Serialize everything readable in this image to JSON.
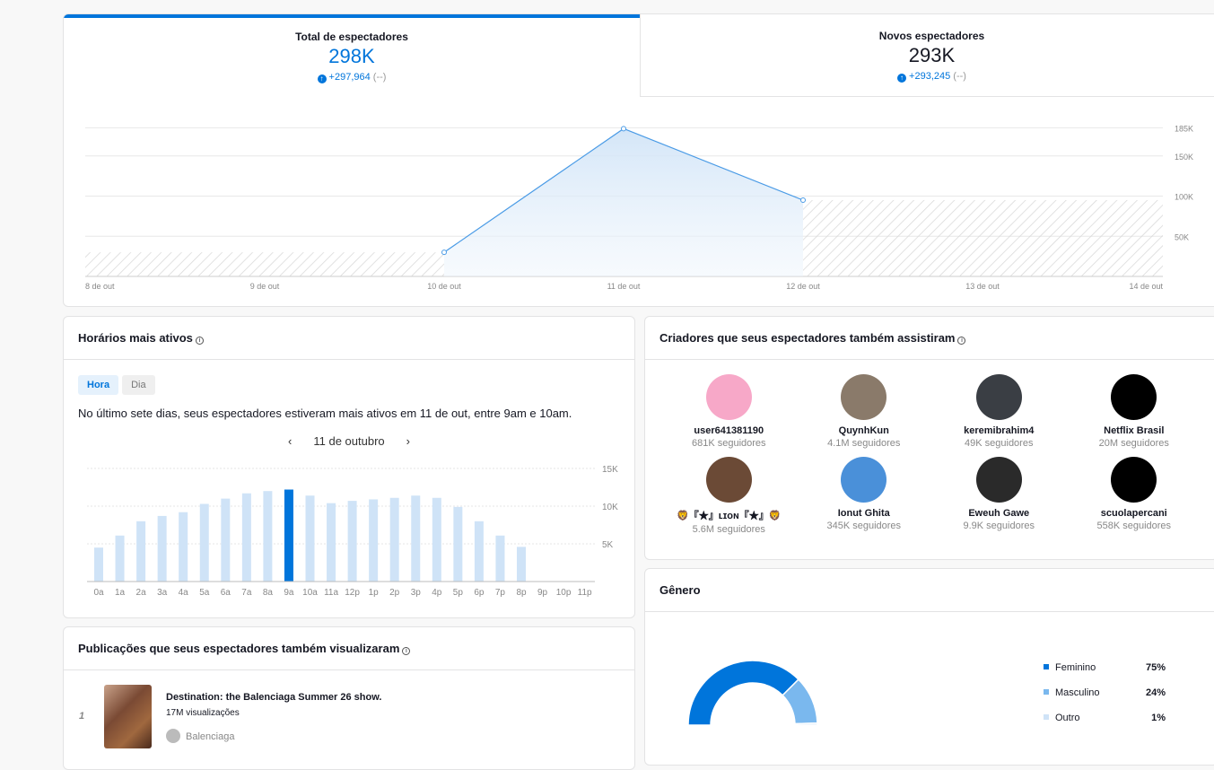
{
  "tabs": [
    {
      "title": "Total de espectadores",
      "value": "298K",
      "delta": "+297,964",
      "delta_note": "(--)"
    },
    {
      "title": "Novos espectadores",
      "value": "293K",
      "delta": "+293,245",
      "delta_note": "(--)"
    }
  ],
  "colors": {
    "accent": "#0075db",
    "light": "#cfe3f7",
    "mid": "#7ab8ee"
  },
  "chart_data": [
    {
      "type": "area",
      "x": [
        "8 de out",
        "9 de out",
        "10 de out",
        "11 de out",
        "12 de out",
        "13 de out",
        "14 de out"
      ],
      "series": [
        {
          "name": "Total de espectadores",
          "values": [
            null,
            null,
            30000,
            184000,
            95000,
            null,
            null
          ]
        }
      ],
      "yticks": [
        "50K",
        "100K",
        "150K",
        "185K"
      ],
      "ytick_values": [
        50000,
        100000,
        150000,
        185000
      ],
      "ylim": [
        0,
        200000
      ],
      "grid": true
    },
    {
      "type": "bar",
      "title": "Horários mais ativos",
      "categories": [
        "0a",
        "1a",
        "2a",
        "3a",
        "4a",
        "5a",
        "6a",
        "7a",
        "8a",
        "9a",
        "10a",
        "11a",
        "12p",
        "1p",
        "2p",
        "3p",
        "4p",
        "5p",
        "6p",
        "7p",
        "8p",
        "9p",
        "10p",
        "11p"
      ],
      "values": [
        4500,
        6100,
        8000,
        8700,
        9200,
        10300,
        11000,
        11700,
        12000,
        12200,
        11400,
        10400,
        10700,
        10900,
        11100,
        11400,
        11100,
        9900,
        8000,
        6100,
        4600,
        0,
        0,
        0
      ],
      "highlight": "9a",
      "yticks": [
        "5K",
        "10K",
        "15K"
      ],
      "ytick_values": [
        5000,
        10000,
        15000
      ],
      "ylim": [
        0,
        15000
      ]
    },
    {
      "type": "pie",
      "title": "Gênero",
      "categories": [
        "Feminino",
        "Masculino",
        "Outro"
      ],
      "values": [
        75,
        24,
        1
      ],
      "labels": [
        "75%",
        "24%",
        "1%"
      ]
    }
  ],
  "hours": {
    "title": "Horários mais ativos",
    "toggle_hour": "Hora",
    "toggle_day": "Dia",
    "summary": "No último sete dias, seus espectadores estiveram mais ativos em 11 de out, entre 9am e 10am.",
    "date": "11 de outubro",
    "prev": "‹",
    "next": "›"
  },
  "creators": {
    "title": "Criadores que seus espectadores também assistiram",
    "items": [
      {
        "name": "user641381190",
        "followers": "681K seguidores",
        "color": "#f7a8c8"
      },
      {
        "name": "QuynhKun",
        "followers": "4.1M seguidores",
        "color": "#8a7a6a"
      },
      {
        "name": "keremibrahim4",
        "followers": "49K seguidores",
        "color": "#3a3e44"
      },
      {
        "name": "Netflix Brasil",
        "followers": "20M seguidores",
        "color": "#000000"
      },
      {
        "name": "🦁『★』ʟɪᴏɴ『★』🦁",
        "followers": "5.6M seguidores",
        "color": "#6b4a36"
      },
      {
        "name": "Ionut Ghita",
        "followers": "345K seguidores",
        "color": "#4a90d9"
      },
      {
        "name": "Eweuh Gawe",
        "followers": "9.9K seguidores",
        "color": "#2a2a2a"
      },
      {
        "name": "scuolapercani",
        "followers": "558K seguidores",
        "color": "#000000"
      }
    ]
  },
  "gender": {
    "title": "Gênero",
    "items": [
      {
        "label": "Feminino",
        "pct": "75%"
      },
      {
        "label": "Masculino",
        "pct": "24%"
      },
      {
        "label": "Outro",
        "pct": "1%"
      }
    ]
  },
  "posts": {
    "title": "Publicações que seus espectadores também visualizaram",
    "items": [
      {
        "rank": "1",
        "title": "Destination: the Balenciaga Summer 26 show.",
        "views": "17M visualizações",
        "author": "Balenciaga"
      }
    ]
  }
}
